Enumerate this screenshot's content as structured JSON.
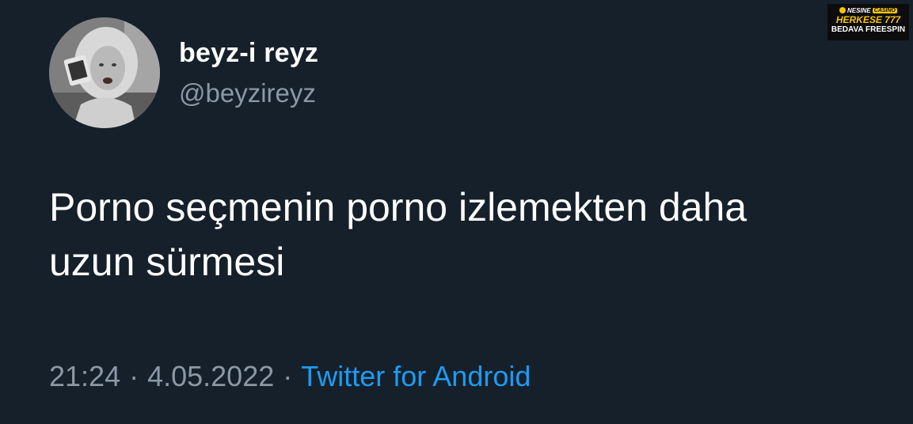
{
  "tweet": {
    "display_name": "beyz-i reyz",
    "handle": "@beyzireyz",
    "text": "Porno seçmenin porno izlemekten daha\nuzun sürmesi",
    "time": "21:24",
    "date": "4.05.2022",
    "separator": "·",
    "source": "Twitter for Android",
    "colors": {
      "background": "#15202b",
      "text": "#ffffff",
      "secondary": "#8b98a5",
      "link": "#1d9bf0"
    }
  },
  "ad_badge": {
    "brand": "NESINE",
    "brand_tag": "CASINO",
    "line1": "HERKESE 777",
    "line2": "BEDAVA FREESPIN",
    "colors": {
      "background": "#0c0c0c",
      "accent": "#f6c400"
    }
  }
}
